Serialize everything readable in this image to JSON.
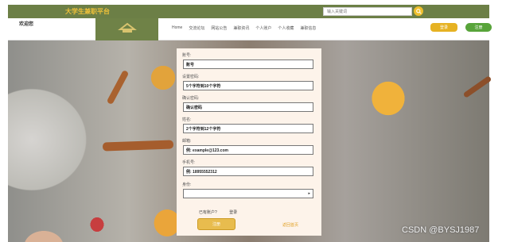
{
  "topbar": {
    "site_title": "大学生兼职平台",
    "search_placeholder": "输入关键词"
  },
  "header": {
    "side_logo": "欢迎您",
    "nav": [
      "Home",
      "交流论坛",
      "网站公告",
      "兼职资讯",
      "个人账户",
      "个人收藏",
      "兼职信息"
    ],
    "login_label": "登录",
    "register_label": "注册"
  },
  "form": {
    "fields": [
      {
        "label": "账号:",
        "value": "账号"
      },
      {
        "label": "设置密码:",
        "value": "5个字符到10个字符"
      },
      {
        "label": "确认密码:",
        "value": "确认密码"
      },
      {
        "label": "姓名:",
        "value": "2个字符到12个字符"
      },
      {
        "label": "邮箱:",
        "value": "例: example@123.com"
      },
      {
        "label": "手机号:",
        "value": "例: 18955552312"
      }
    ],
    "select_label": "身份:",
    "links": [
      "已有账户?",
      "登录"
    ],
    "submit_label": "注册",
    "return_label": "返回首页"
  },
  "watermark": "CSDN @BYSJ1987"
}
